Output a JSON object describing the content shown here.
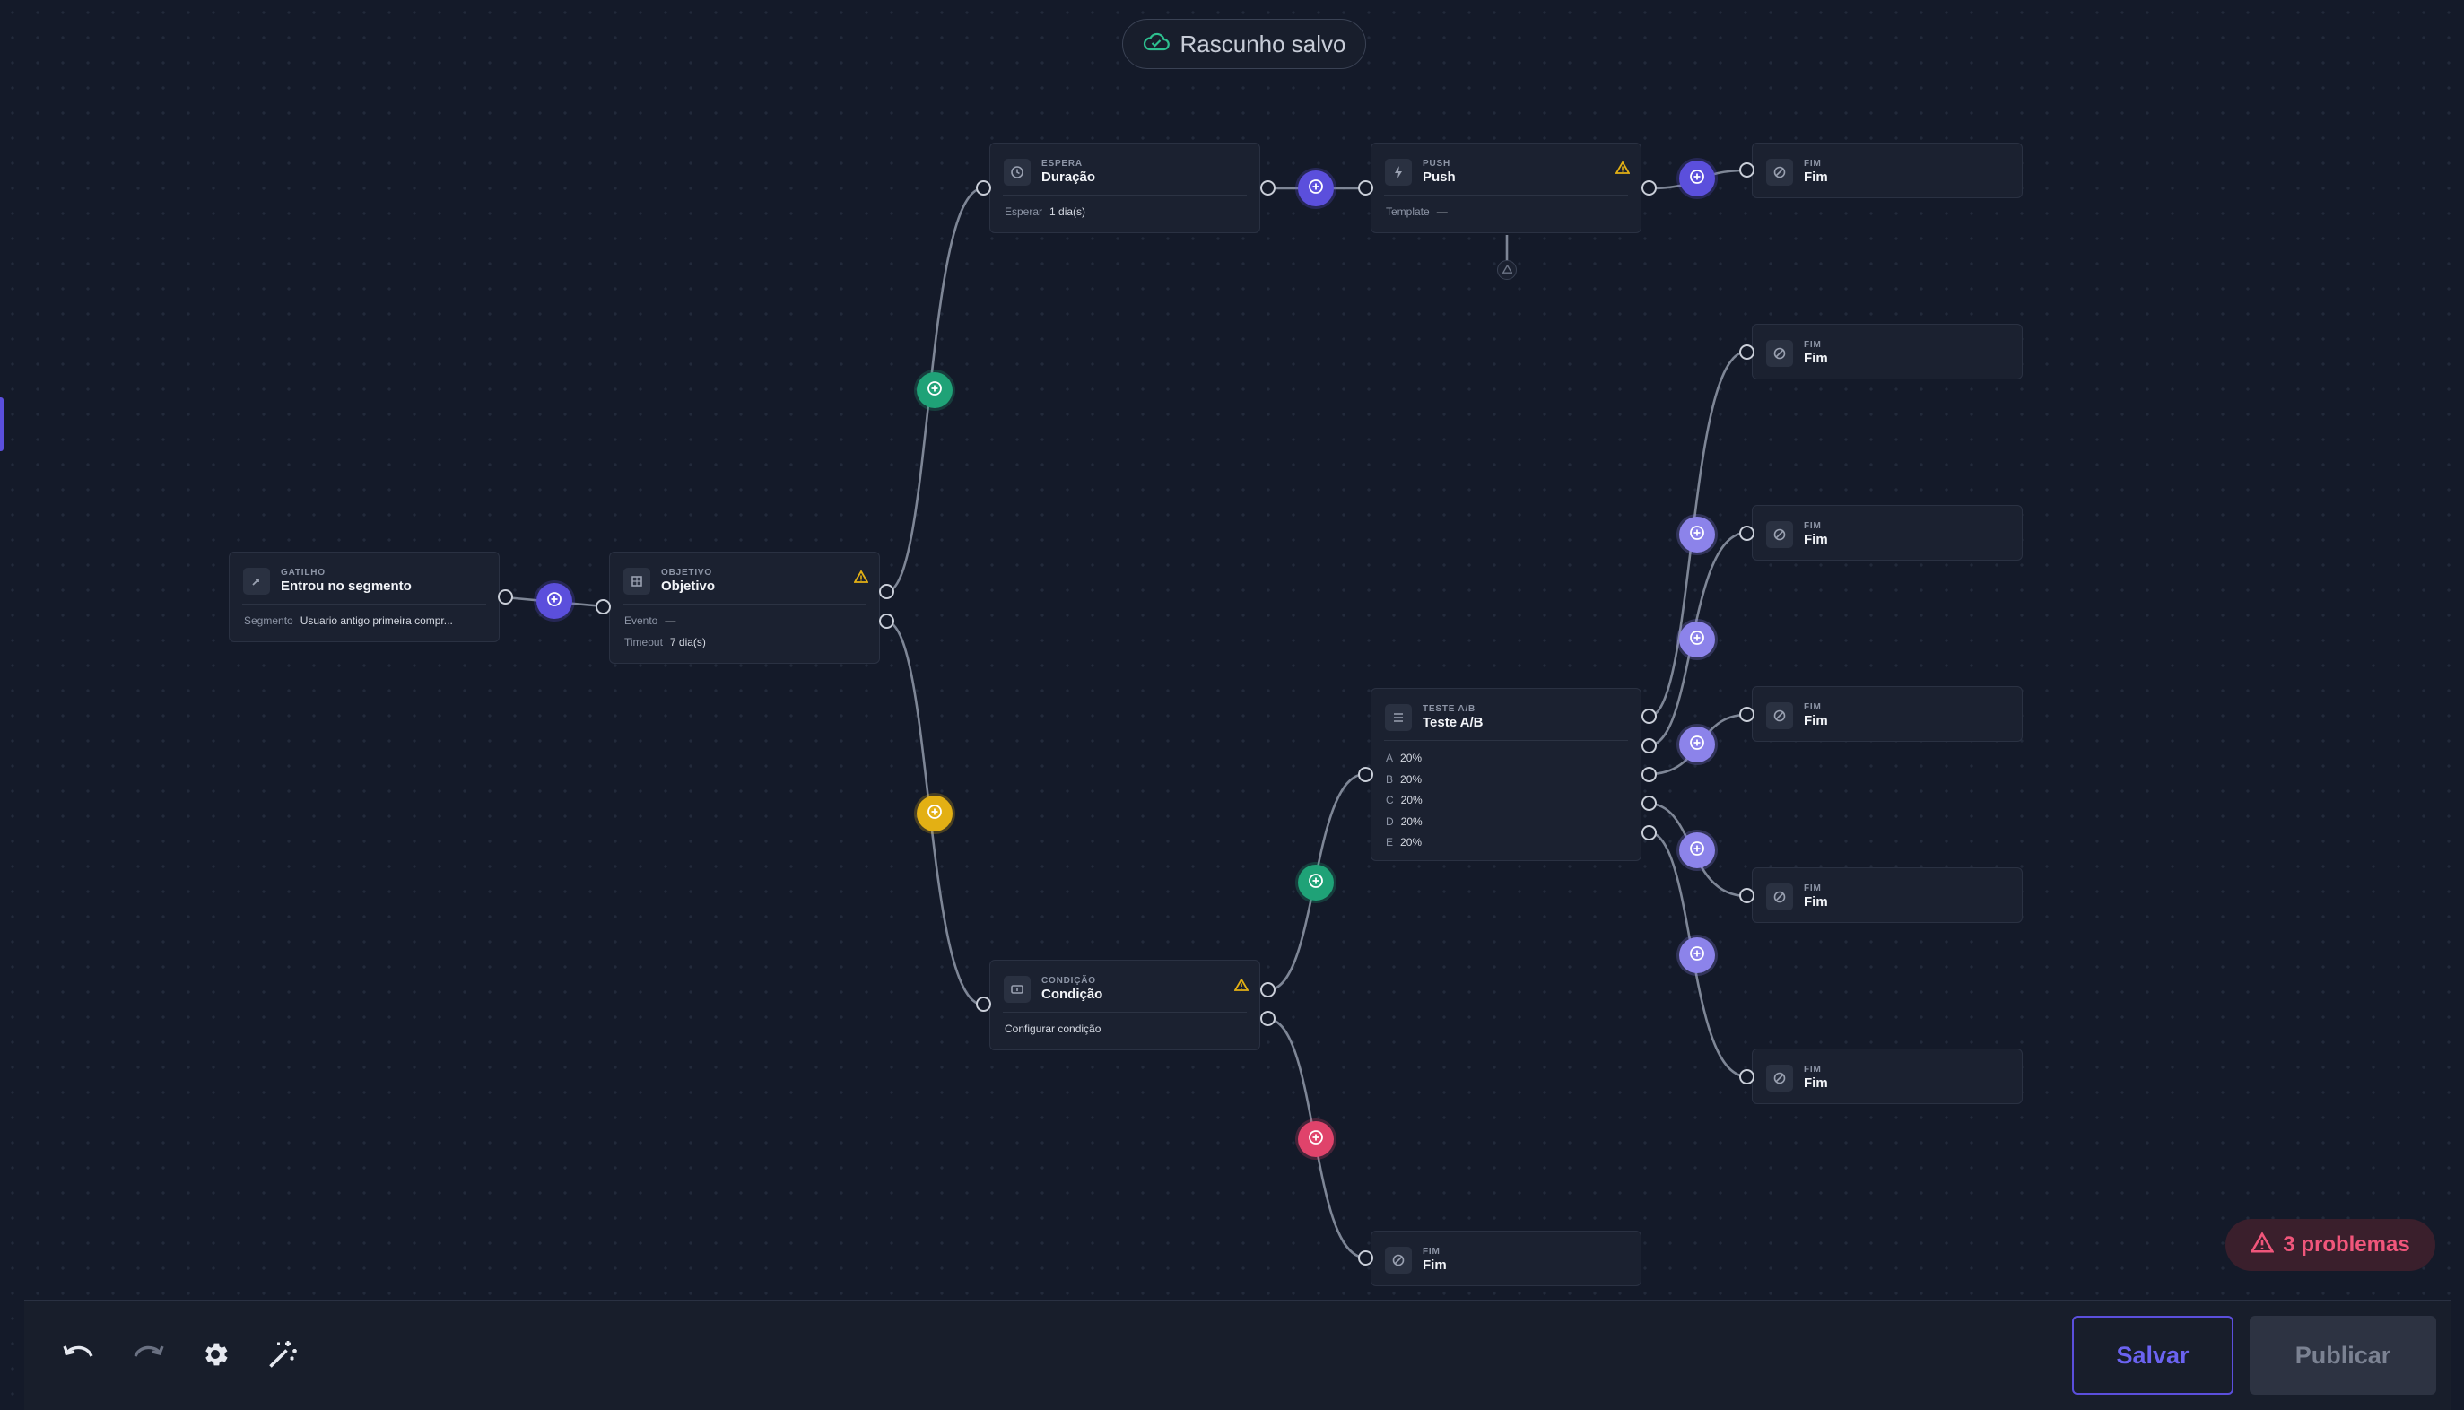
{
  "draft_status": {
    "label": "Rascunho salvo",
    "icon": "cloud-check-icon"
  },
  "nodes": {
    "trigger": {
      "kind": "GATILHO",
      "title": "Entrou no segmento",
      "segment_key": "Segmento",
      "segment_value": "Usuario antigo primeira compr..."
    },
    "goal": {
      "kind": "OBJETIVO",
      "title": "Objetivo",
      "event_key": "Evento",
      "event_value": "—",
      "timeout_key": "Timeout",
      "timeout_value": "7 dia(s)"
    },
    "wait": {
      "kind": "ESPERA",
      "title": "Duração",
      "wait_key": "Esperar",
      "wait_value": "1 dia(s)"
    },
    "push": {
      "kind": "PUSH",
      "title": "Push",
      "template_key": "Template",
      "template_value": "—"
    },
    "condition": {
      "kind": "CONDIÇÃO",
      "title": "Condição",
      "body": "Configurar condição"
    },
    "abtest": {
      "kind": "TESTE A/B",
      "title": "Teste A/B",
      "variants": [
        {
          "label": "A",
          "value": "20%"
        },
        {
          "label": "B",
          "value": "20%"
        },
        {
          "label": "C",
          "value": "20%"
        },
        {
          "label": "D",
          "value": "20%"
        },
        {
          "label": "E",
          "value": "20%"
        }
      ]
    },
    "ends": [
      {
        "kind": "FIM",
        "title": "Fim"
      },
      {
        "kind": "FIM",
        "title": "Fim"
      },
      {
        "kind": "FIM",
        "title": "Fim"
      },
      {
        "kind": "FIM",
        "title": "Fim"
      },
      {
        "kind": "FIM",
        "title": "Fim"
      },
      {
        "kind": "FIM",
        "title": "Fim"
      },
      {
        "kind": "FIM",
        "title": "Fim"
      }
    ]
  },
  "problems": {
    "label": "3 problemas",
    "color": "#f0567b"
  },
  "toolbar": {
    "save_label": "Salvar",
    "publish_label": "Publicar"
  },
  "colors": {
    "accent": "#5b4fdc",
    "lavender": "#8c83ea",
    "success": "#1fa277",
    "warning": "#e3b014",
    "danger": "#e0436b"
  }
}
